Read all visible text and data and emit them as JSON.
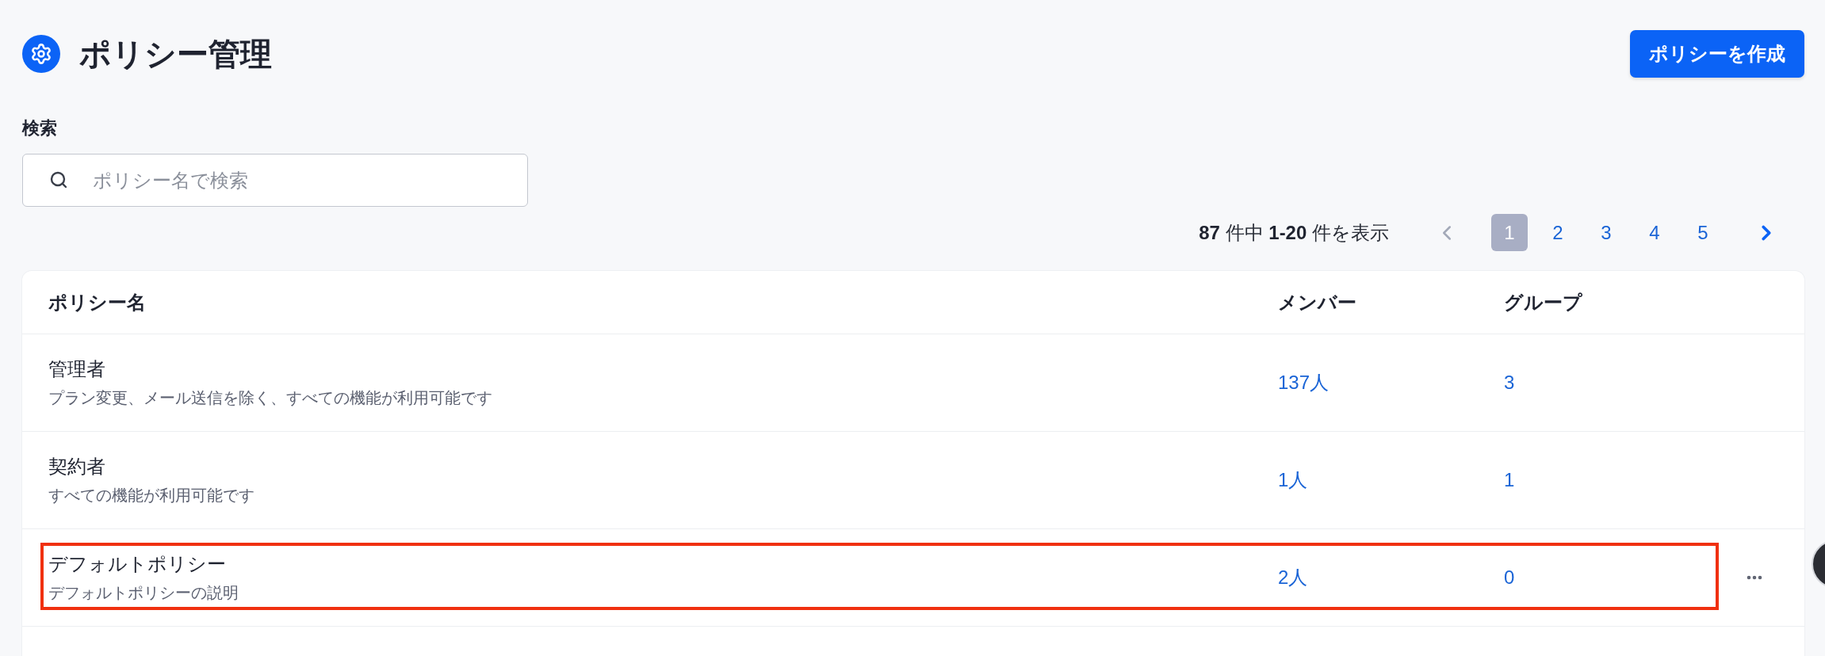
{
  "header": {
    "title": "ポリシー管理",
    "create_button": "ポリシーを作成"
  },
  "search": {
    "label": "検索",
    "placeholder": "ポリシー名で検索"
  },
  "pagination": {
    "summary": "**87** 件中 **1-20** 件を表示",
    "previous": {
      "disabled": true
    },
    "next": {
      "disabled": false
    },
    "pages": [
      {
        "label": "1",
        "selected": true
      },
      {
        "label": "2",
        "selected": false
      },
      {
        "label": "3",
        "selected": false
      },
      {
        "label": "4",
        "selected": false
      },
      {
        "label": "5",
        "selected": false
      }
    ]
  },
  "table": {
    "columns": [
      "ポリシー名",
      "メンバー",
      "グループ"
    ],
    "rows": [
      {
        "name": "管理者",
        "description": "プラン変更、メール送信を除く、すべての機能が利用可能です",
        "members": "137人",
        "groups": "3",
        "highlighted": false,
        "actions_visible": false
      },
      {
        "name": "契約者",
        "description": "すべての機能が利用可能です",
        "members": "1人",
        "groups": "1",
        "highlighted": false,
        "actions_visible": false
      },
      {
        "name": "デフォルトポリシー",
        "description": "デフォルトポリシーの説明",
        "members": "2人",
        "groups": "0",
        "highlighted": true,
        "actions_visible": true
      }
    ]
  }
}
